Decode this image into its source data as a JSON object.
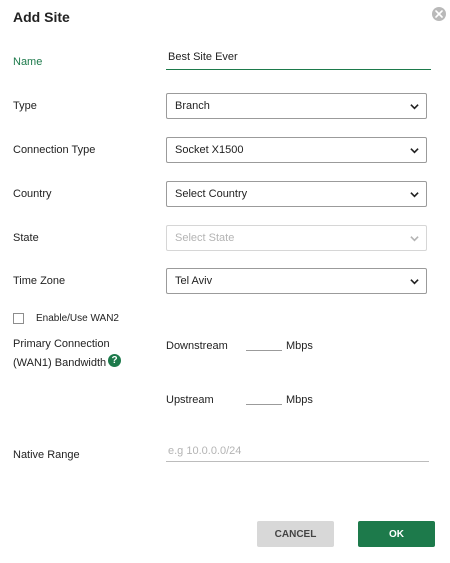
{
  "dialog": {
    "title": "Add Site"
  },
  "form": {
    "name": {
      "label": "Name",
      "value": "Best Site Ever"
    },
    "type": {
      "label": "Type",
      "value": "Branch"
    },
    "connection_type": {
      "label": "Connection Type",
      "value": "Socket X1500"
    },
    "country": {
      "label": "Country",
      "value": "Select Country"
    },
    "state": {
      "label": "State",
      "value": "Select State"
    },
    "time_zone": {
      "label": "Time Zone",
      "value": "Tel Aviv"
    },
    "enable_wan2": {
      "label": "Enable/Use WAN2",
      "checked": false
    },
    "bandwidth": {
      "label_line1": "Primary Connection",
      "label_line2": "(WAN1) Bandwidth",
      "help_icon": "?",
      "downstream_label": "Downstream",
      "upstream_label": "Upstream",
      "unit": "Mbps"
    },
    "native_range": {
      "label": "Native Range",
      "placeholder": "e.g 10.0.0.0/24"
    }
  },
  "buttons": {
    "cancel": "CANCEL",
    "ok": "OK"
  },
  "colors": {
    "accent": "#1d7a4b",
    "cancel_bg": "#d8d8d8"
  }
}
